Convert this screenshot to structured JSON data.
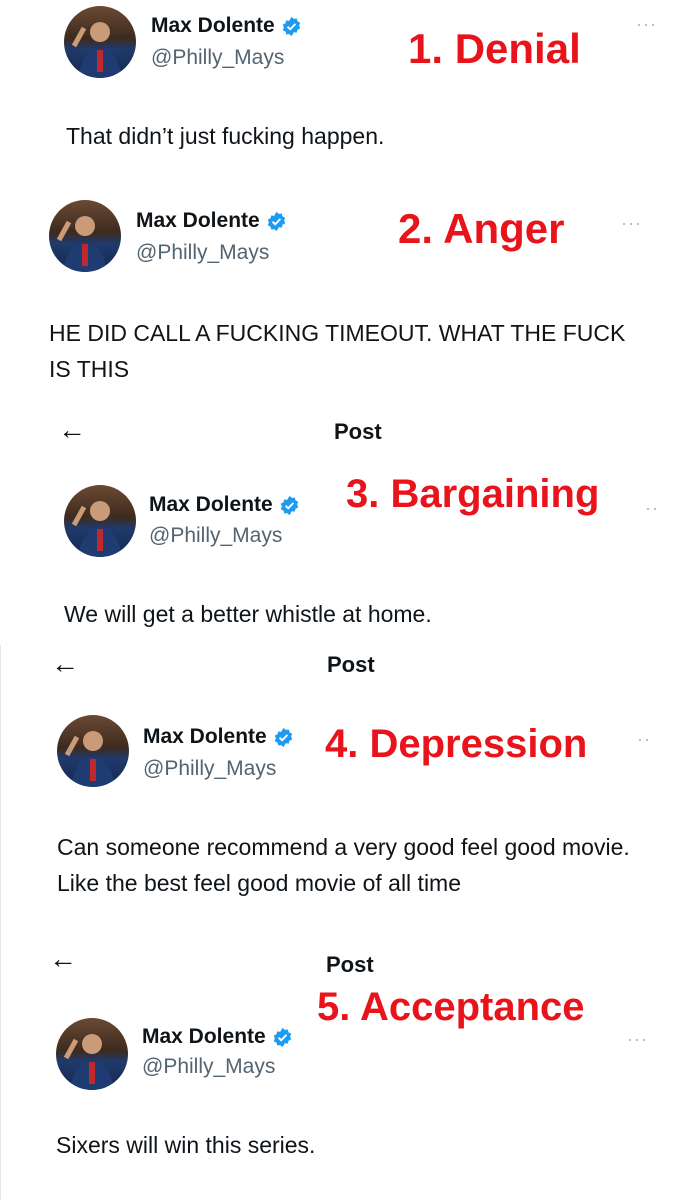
{
  "colors": {
    "stage_label": "#e8131b",
    "verified": "#1d9bf0",
    "handle": "#536471"
  },
  "header": {
    "back_icon": "arrow-left-icon",
    "title": "Post"
  },
  "tweets": [
    {
      "author": "Max Dolente",
      "handle": "@Philly_Mays",
      "stage": "1. Denial",
      "text": "That didn’t just fucking happen."
    },
    {
      "author": "Max Dolente",
      "handle": "@Philly_Mays",
      "stage": "2. Anger",
      "text": "HE DID CALL A FUCKING TIMEOUT. WHAT THE FUCK IS THIS"
    },
    {
      "author": "Max Dolente",
      "handle": "@Philly_Mays",
      "stage": "3. Bargaining",
      "text": "We will get a better whistle at home."
    },
    {
      "author": "Max Dolente",
      "handle": "@Philly_Mays",
      "stage": "4. Depression",
      "text": "Can someone recommend a very good feel good movie. Like the best feel good movie of all time"
    },
    {
      "author": "Max Dolente",
      "handle": "@Philly_Mays",
      "stage": "5. Acceptance",
      "text": "Sixers will win this series."
    }
  ],
  "more_icon": "ellipsis-icon"
}
